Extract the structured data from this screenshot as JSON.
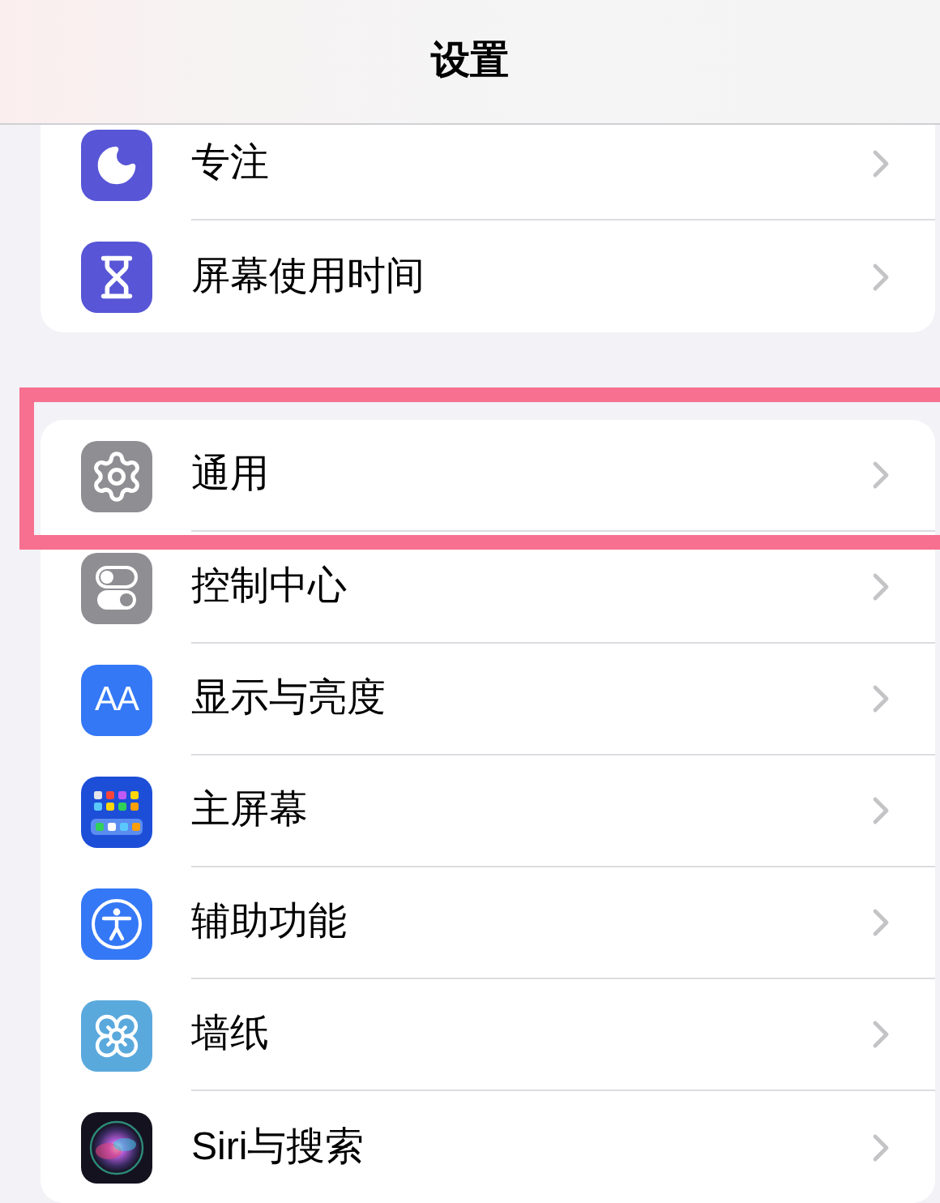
{
  "nav_bar": {
    "title": "设置"
  },
  "groups": [
    {
      "items": [
        {
          "label": "专注",
          "highlighted": false
        },
        {
          "label": "屏幕使用时间",
          "highlighted": false
        }
      ]
    },
    {
      "items": [
        {
          "label": "通用",
          "highlighted": true
        },
        {
          "label": "控制中心",
          "highlighted": false
        },
        {
          "label": "显示与亮度",
          "icon_text": "AA",
          "highlighted": false
        },
        {
          "label": "主屏幕",
          "highlighted": false
        },
        {
          "label": "辅助功能",
          "highlighted": false
        },
        {
          "label": "墙纸",
          "highlighted": false
        },
        {
          "label": "Siri与搜索",
          "highlighted": false
        }
      ]
    }
  ]
}
